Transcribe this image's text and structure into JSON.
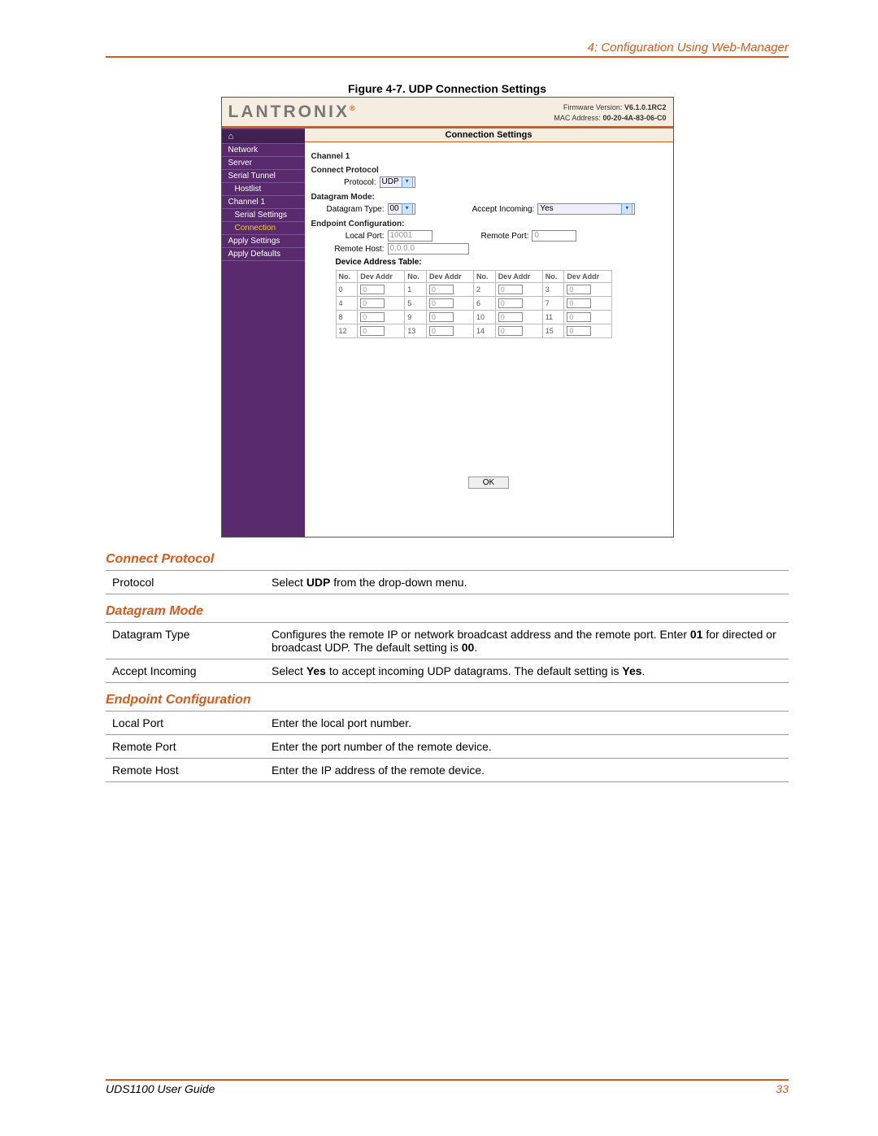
{
  "chapter_title": "4: Configuration Using Web-Manager",
  "figure_caption": "Figure 4-7. UDP Connection Settings",
  "screenshot": {
    "logo_text": "LANTRONIX",
    "firmware_lbl": "Firmware Version:",
    "firmware_val": "V6.1.0.1RC2",
    "mac_lbl": "MAC Address:",
    "mac_val": "00-20-4A-83-06-C0",
    "panel_title": "Connection Settings",
    "nav": {
      "home": "⌂",
      "items": [
        "Network",
        "Server",
        "Serial Tunnel",
        "Hostlist",
        "Channel 1",
        "Serial Settings",
        "Connection",
        "Apply Settings",
        "Apply Defaults"
      ]
    },
    "ch_label": "Channel 1",
    "cp_label": "Connect Protocol",
    "protocol_lbl": "Protocol:",
    "protocol_val": "UDP",
    "dg_label": "Datagram Mode:",
    "dg_type_lbl": "Datagram Type:",
    "dg_type_val": "00",
    "accept_lbl": "Accept Incoming:",
    "accept_val": "Yes",
    "ep_label": "Endpoint Configuration:",
    "local_port_lbl": "Local Port:",
    "local_port_val": "10001",
    "remote_port_lbl": "Remote Port:",
    "remote_port_val": "0",
    "remote_host_lbl": "Remote Host:",
    "remote_host_val": "0.0.0.0",
    "dev_table_caption": "Device Address Table:",
    "dev_table_hdr": [
      "No.",
      "Dev Addr",
      "No.",
      "Dev Addr",
      "No.",
      "Dev Addr",
      "No.",
      "Dev Addr"
    ],
    "dev_rows": [
      [
        "0",
        "0",
        "1",
        "0",
        "2",
        "0",
        "3",
        "0"
      ],
      [
        "4",
        "0",
        "5",
        "0",
        "6",
        "0",
        "7",
        "0"
      ],
      [
        "8",
        "0",
        "9",
        "0",
        "10",
        "0",
        "11",
        "0"
      ],
      [
        "12",
        "0",
        "13",
        "0",
        "14",
        "0",
        "15",
        "0"
      ]
    ],
    "ok_label": "OK"
  },
  "sec1": {
    "title": "Connect Protocol",
    "rows": [
      {
        "k": "Protocol",
        "v_pre": "Select ",
        "v_b": "UDP",
        "v_post": " from the drop-down menu."
      }
    ]
  },
  "sec2": {
    "title": "Datagram Mode",
    "rows": [
      {
        "k": "Datagram Type",
        "v_pre": "Configures the remote IP or network broadcast address and the remote port. Enter ",
        "v_b": "01",
        "v_mid": " for directed or broadcast UDP. The default setting is ",
        "v_b2": "00",
        "v_post": "."
      },
      {
        "k": "Accept Incoming",
        "v_pre": "Select ",
        "v_b": "Yes",
        "v_mid": " to accept incoming UDP datagrams. The default setting is ",
        "v_b2": "Yes",
        "v_post": "."
      }
    ]
  },
  "sec3": {
    "title": "Endpoint Configuration",
    "rows": [
      {
        "k": "Local Port",
        "v": "Enter the local port number."
      },
      {
        "k": "Remote Port",
        "v": "Enter the port number of the remote device."
      },
      {
        "k": "Remote Host",
        "v": "Enter the IP address of the remote device."
      }
    ]
  },
  "footer": {
    "guide": "UDS1100 User Guide",
    "page": "33"
  }
}
